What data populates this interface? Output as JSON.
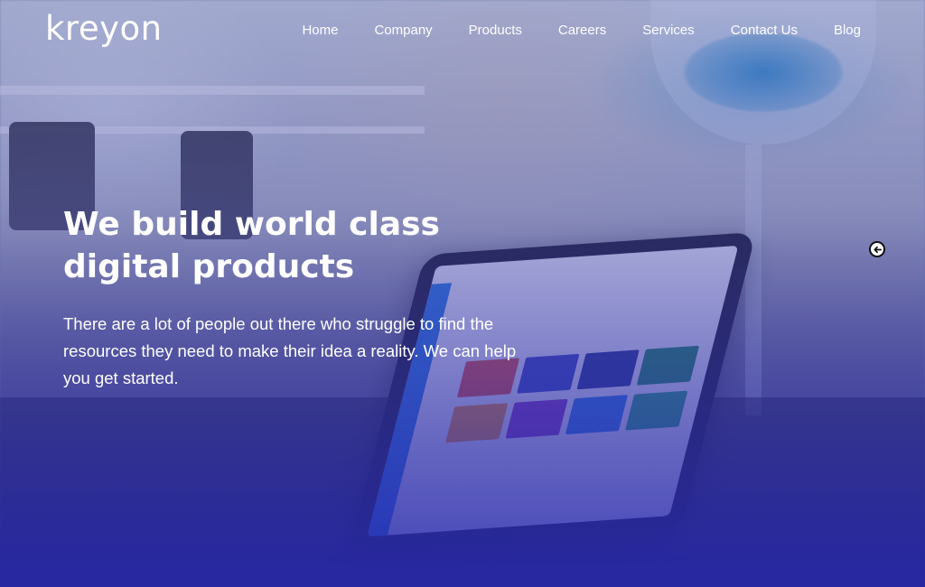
{
  "brand": {
    "logo_text": "kreyon"
  },
  "nav": {
    "items": [
      {
        "label": "Home"
      },
      {
        "label": "Company"
      },
      {
        "label": "Products"
      },
      {
        "label": "Careers"
      },
      {
        "label": "Services"
      },
      {
        "label": "Contact Us"
      },
      {
        "label": "Blog"
      }
    ]
  },
  "hero": {
    "headline_line1": "We build world class",
    "headline_line2": "digital products",
    "description": "There are a lot of people out there who struggle to find the resources they need to make their idea a reality. We can help you get started."
  },
  "slider": {
    "arrow_icon": "circle-arrow-left-icon"
  },
  "colors": {
    "overlay": "#3a3ab0",
    "text": "#ffffff"
  }
}
